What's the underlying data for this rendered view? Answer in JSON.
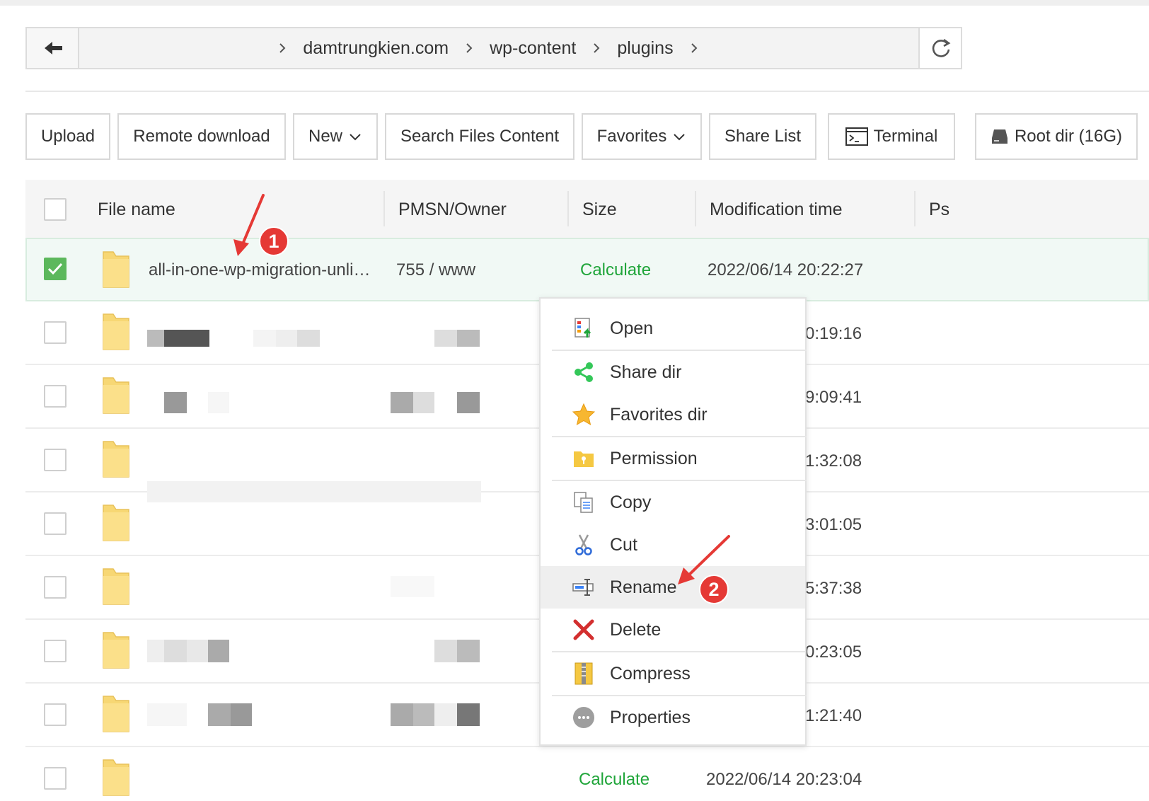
{
  "breadcrumb": {
    "segments": [
      "damtrungkien.com",
      "wp-content",
      "plugins"
    ]
  },
  "toolbar": {
    "upload": "Upload",
    "remote_download": "Remote download",
    "new": "New",
    "search_files_content": "Search Files Content",
    "favorites": "Favorites",
    "share_list": "Share List",
    "terminal": "Terminal",
    "root_dir": "Root dir (16G)"
  },
  "table": {
    "headers": {
      "file_name": "File name",
      "pmsn_owner": "PMSN/Owner",
      "size": "Size",
      "modification_time": "Modification time",
      "ps": "Ps"
    },
    "rows": [
      {
        "name": "all-in-one-wp-migration-unli…",
        "owner": "755 / www",
        "size": "Calculate",
        "mtime": "2022/06/14 20:22:27",
        "checked": true
      },
      {
        "name": "",
        "owner": "",
        "size": "",
        "mtime": "0:19:16",
        "checked": false
      },
      {
        "name": "",
        "owner": "",
        "size": "",
        "mtime": "9:09:41",
        "checked": false
      },
      {
        "name": "",
        "owner": "",
        "size": "",
        "mtime": "1:32:08",
        "checked": false
      },
      {
        "name": "",
        "owner": "",
        "size": "",
        "mtime": "3:01:05",
        "checked": false
      },
      {
        "name": "",
        "owner": "",
        "size": "",
        "mtime": "5:37:38",
        "checked": false
      },
      {
        "name": "",
        "owner": "",
        "size": "",
        "mtime": "0:23:05",
        "checked": false
      },
      {
        "name": "",
        "owner": "",
        "size": "",
        "mtime": "1:21:40",
        "checked": false
      },
      {
        "name": "",
        "owner": "",
        "size": "Calculate",
        "mtime": "2022/06/14 20:23:04",
        "checked": false
      }
    ]
  },
  "context_menu": {
    "items": [
      {
        "label": "Open",
        "icon": "open-icon"
      },
      {
        "label": "Share dir",
        "icon": "share-icon"
      },
      {
        "label": "Favorites dir",
        "icon": "star-icon"
      },
      {
        "label": "Permission",
        "icon": "permission-folder-icon"
      },
      {
        "label": "Copy",
        "icon": "copy-icon"
      },
      {
        "label": "Cut",
        "icon": "scissors-icon"
      },
      {
        "label": "Rename",
        "icon": "rename-icon"
      },
      {
        "label": "Delete",
        "icon": "delete-icon"
      },
      {
        "label": "Compress",
        "icon": "compress-icon"
      },
      {
        "label": "Properties",
        "icon": "properties-icon"
      }
    ],
    "hovered": "Rename"
  },
  "annotations": {
    "badge1": "1",
    "badge2": "2"
  },
  "colors": {
    "accent_green": "#20a53a",
    "checkbox_green": "#5cb85c",
    "annotation_red": "#e53935",
    "folder_yellow": "#f7d774"
  }
}
